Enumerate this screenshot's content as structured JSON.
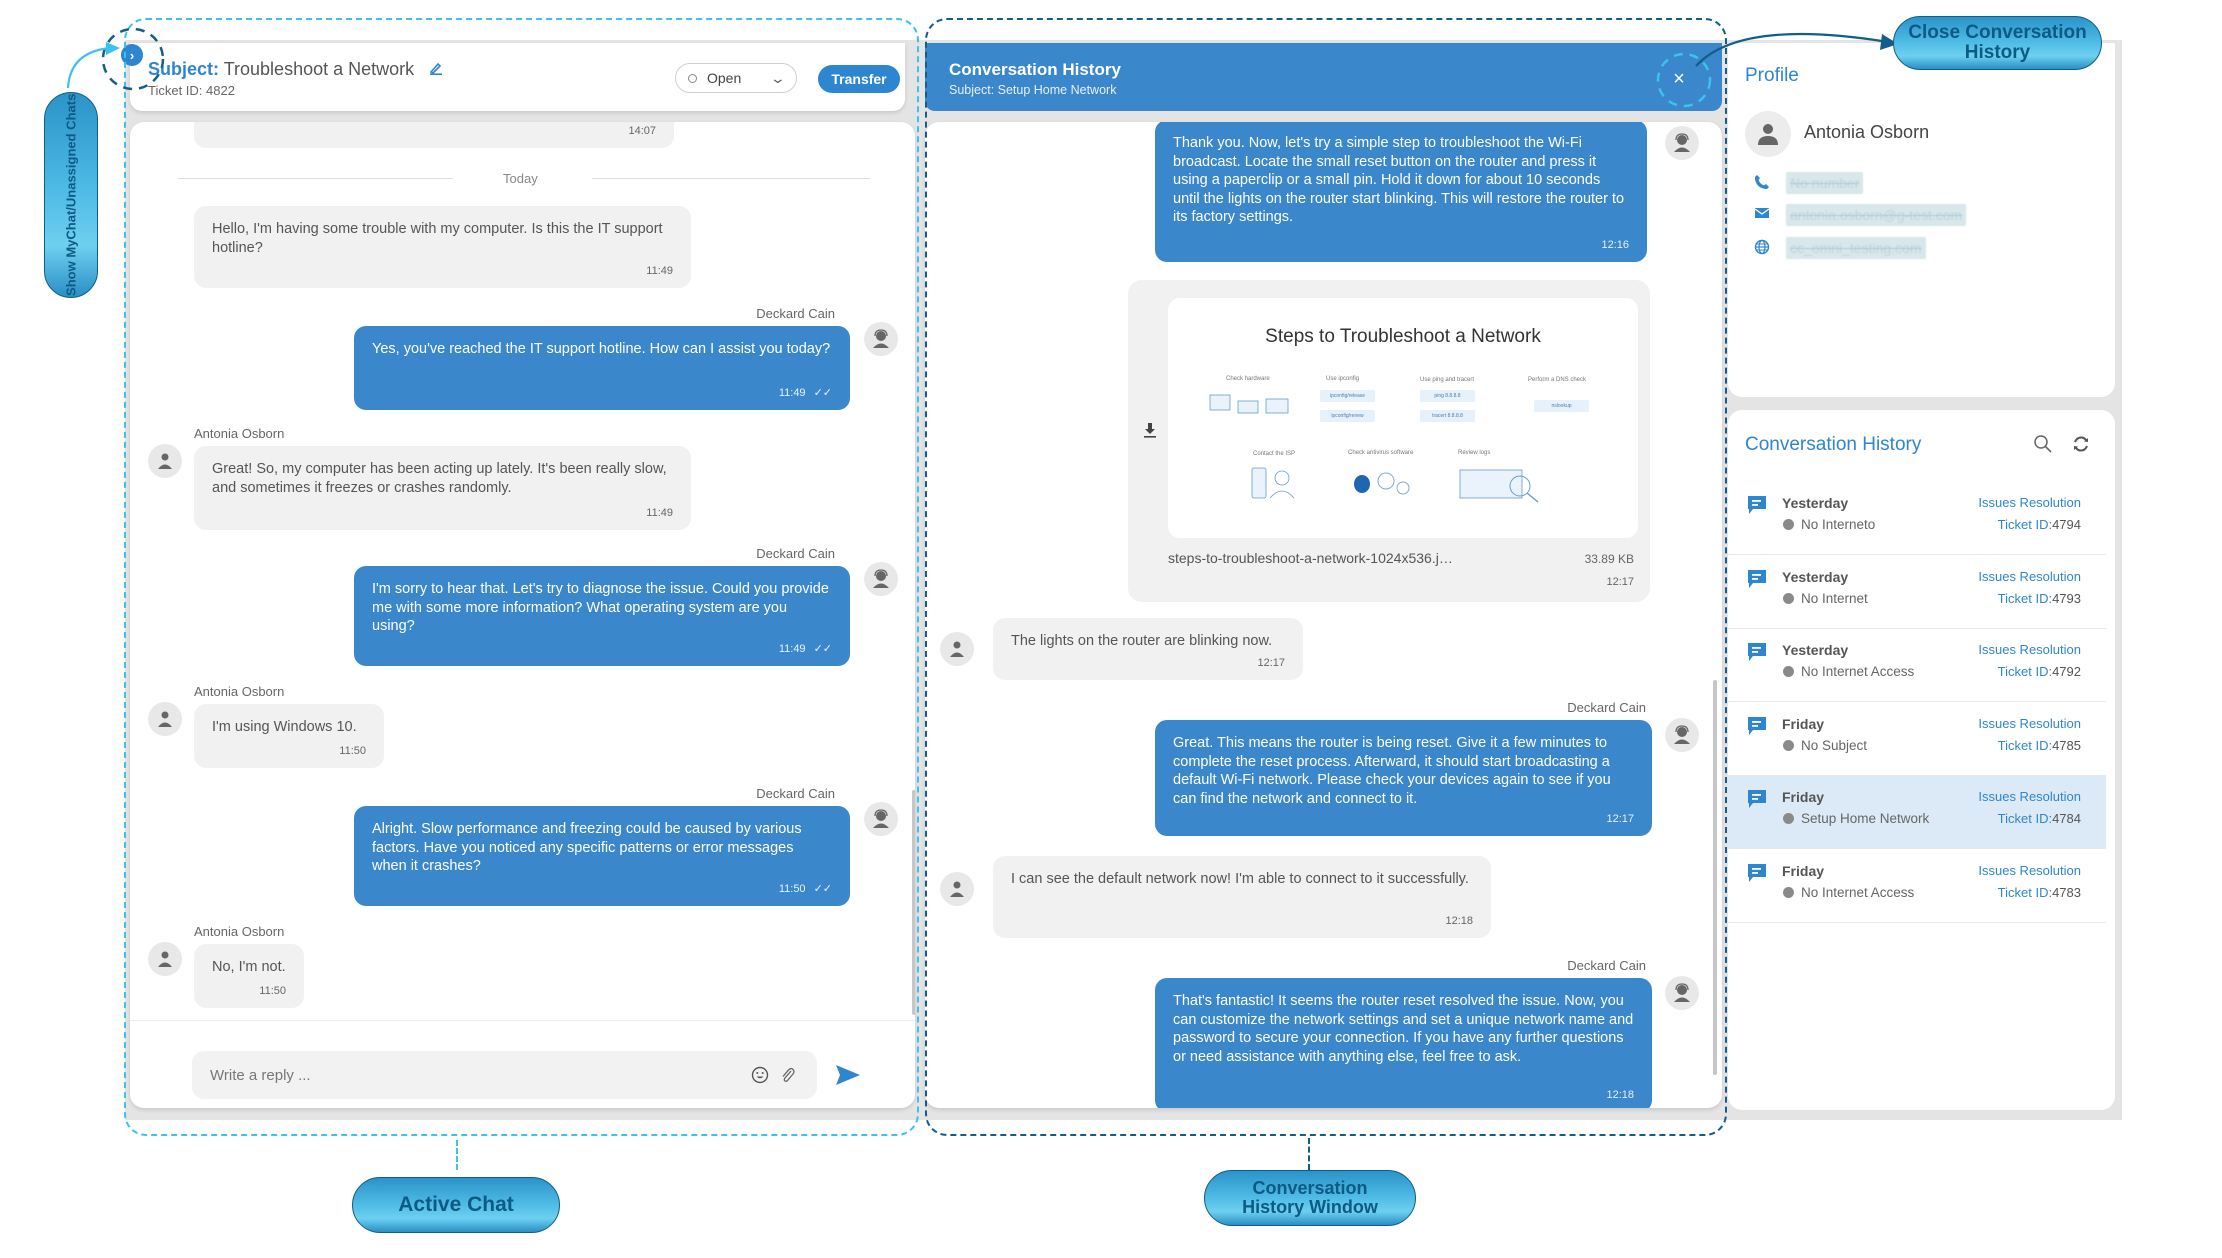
{
  "active_chat": {
    "subject_label": "Subject:",
    "subject": "Troubleshoot a Network",
    "ticket_id": "Ticket ID: 4822",
    "status": "Open",
    "transfer_label": "Transfer",
    "earlier_time": "14:07",
    "day_divider": "Today",
    "messages": [
      {
        "from": "Antonia Osborn",
        "dir": "in",
        "text": "Hello, I'm having some trouble with my computer. Is this the IT support hotline?",
        "time": "11:49",
        "show_sender": false
      },
      {
        "from": "Deckard Cain",
        "dir": "out",
        "text": "Yes, you've reached the IT support hotline. How can I assist you today?",
        "time": "11:49",
        "ticks": "✓✓"
      },
      {
        "from": "Antonia Osborn",
        "dir": "in",
        "text": "Great! So, my computer has been acting up lately. It's been really slow, and sometimes it freezes or crashes randomly.",
        "time": "11:49"
      },
      {
        "from": "Deckard Cain",
        "dir": "out",
        "text": "I'm sorry to hear that. Let's try to diagnose the issue. Could you provide me with some more information? What operating system are you using?",
        "time": "11:49",
        "ticks": "✓✓"
      },
      {
        "from": "Antonia Osborn",
        "dir": "in",
        "text": "I'm using Windows 10.",
        "time": "11:50"
      },
      {
        "from": "Deckard Cain",
        "dir": "out",
        "text": "Alright. Slow performance and freezing could be caused by various factors. Have you noticed any specific patterns or error messages when it crashes?",
        "time": "11:50",
        "ticks": "✓✓"
      },
      {
        "from": "Antonia Osborn",
        "dir": "in",
        "text": "No, I'm not.",
        "time": "11:50"
      }
    ],
    "reply_placeholder": "Write a reply ..."
  },
  "history_window": {
    "title": "Conversation History",
    "subject": "Subject: Setup Home Network",
    "close_label": "×",
    "messages": [
      {
        "from": "Deckard Cain",
        "dir": "out",
        "text": "Thank you. Now, let's try a simple step to troubleshoot the Wi-Fi broadcast. Locate the small reset button on the router and press it using a paperclip or a small pin. Hold it down for about 10 seconds until the lights on the router start blinking. This will restore the router to its factory settings.",
        "time": "12:16"
      },
      {
        "from": "Antonia Osborn",
        "dir": "in",
        "text": "The lights on the router are blinking now.",
        "time": "12:17"
      },
      {
        "from": "Deckard Cain",
        "dir": "out",
        "text": "Great. This means the router is being reset. Give it a few minutes to complete the reset process. Afterward, it should start broadcasting a default Wi-Fi network. Please check your devices again to see if you can find the network and connect to it.",
        "time": "12:17"
      },
      {
        "from": "Antonia Osborn",
        "dir": "in",
        "text": "I can see the default network now! I'm able to connect to it successfully.",
        "time": "12:18"
      },
      {
        "from": "Deckard Cain",
        "dir": "out",
        "text": "That's fantastic! It seems the router reset resolved the issue. Now, you can customize the network settings and set a unique network name and password to secure your connection. If you have any further questions or need assistance with anything else, feel free to ask.",
        "time": "12:18"
      }
    ],
    "attachment": {
      "image_title": "Steps to Troubleshoot a Network",
      "labels": [
        "Check hardware",
        "Use ipconfig",
        "Use ping and tracert",
        "Perform a DNS check",
        "Contact the ISP",
        "Check antivirus software",
        "Review logs"
      ],
      "chips": [
        "ipconfig/release",
        "ipconfig/renew",
        "ping 8.8.8.8",
        "tracert 8.8.8.8",
        "nslookup"
      ],
      "filename": "steps-to-troubleshoot-a-network-1024x536.j…",
      "size": "33.89 KB",
      "time": "12:17"
    }
  },
  "profile": {
    "title": "Profile",
    "name": "Antonia Osborn",
    "phone": "No number",
    "email": "antonia.osborn@g-test.com",
    "website": "cc_omni_testing.com"
  },
  "conversation_history": {
    "title": "Conversation History",
    "items": [
      {
        "day": "Yesterday",
        "subject": "No Interneto",
        "category": "Issues Resolution",
        "ticket_label": "Ticket ID:",
        "ticket": "4794",
        "active": false
      },
      {
        "day": "Yesterday",
        "subject": "No Internet",
        "category": "Issues Resolution",
        "ticket_label": "Ticket ID:",
        "ticket": "4793",
        "active": false
      },
      {
        "day": "Yesterday",
        "subject": "No Internet Access",
        "category": "Issues Resolution",
        "ticket_label": "Ticket ID:",
        "ticket": "4792",
        "active": false
      },
      {
        "day": "Friday",
        "subject": "No Subject",
        "category": "Issues Resolution",
        "ticket_label": "Ticket ID:",
        "ticket": "4785",
        "active": false
      },
      {
        "day": "Friday",
        "subject": "Setup Home Network",
        "category": "Issues Resolution",
        "ticket_label": "Ticket ID:",
        "ticket": "4784",
        "active": true
      },
      {
        "day": "Friday",
        "subject": "No Internet Access",
        "category": "Issues Resolution",
        "ticket_label": "Ticket ID:",
        "ticket": "4783",
        "active": false
      }
    ]
  },
  "annotations": {
    "show_chats": "Show MyChat/Unassigned Chats",
    "close_history": "Close Conversation History",
    "active_chat": "Active Chat",
    "history_window": "Conversation History Window"
  },
  "colors": {
    "accent": "#2f86d0",
    "outgoing_bubble": "#3a87cc",
    "incoming_bubble": "#f1f1f1",
    "active_row": "#dbeaf6",
    "frame": "#e4e4e4"
  }
}
